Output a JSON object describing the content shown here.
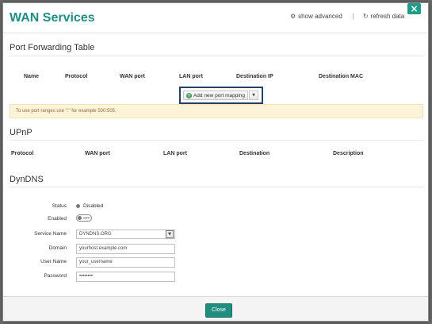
{
  "dialog": {
    "title": "WAN Services",
    "close_icon": "close-icon",
    "show_advanced": "show advanced",
    "refresh_data": "refresh data",
    "separator": "|"
  },
  "port_forwarding": {
    "title": "Port Forwarding Table",
    "columns": [
      "Name",
      "Protocol",
      "WAN port",
      "LAN port",
      "Destination IP",
      "Destination MAC"
    ],
    "add_button": "Add new port mapping",
    "note": "To use port ranges use \":\" for example 500:505."
  },
  "upnp": {
    "title": "UPnP",
    "columns": [
      "Protocol",
      "WAN port",
      "LAN port",
      "Destination",
      "Description"
    ]
  },
  "dyndns": {
    "title": "DynDNS",
    "status_label": "Status",
    "status_value": "Disabled",
    "enabled_label": "Enabled",
    "enabled_toggle": "OFF",
    "service_name_label": "Service Name",
    "service_name_value": "DYNDNS.ORG",
    "domain_label": "Domain",
    "domain_placeholder": "yourhost.example.com",
    "username_label": "User Name",
    "username_placeholder": "your_username",
    "password_label": "Password",
    "password_value": "••••••••"
  },
  "footer": {
    "close_label": "Close"
  },
  "colors": {
    "accent": "#1e8f82",
    "note_bg": "#fcf3d9",
    "focus_border": "#2a3f66"
  }
}
